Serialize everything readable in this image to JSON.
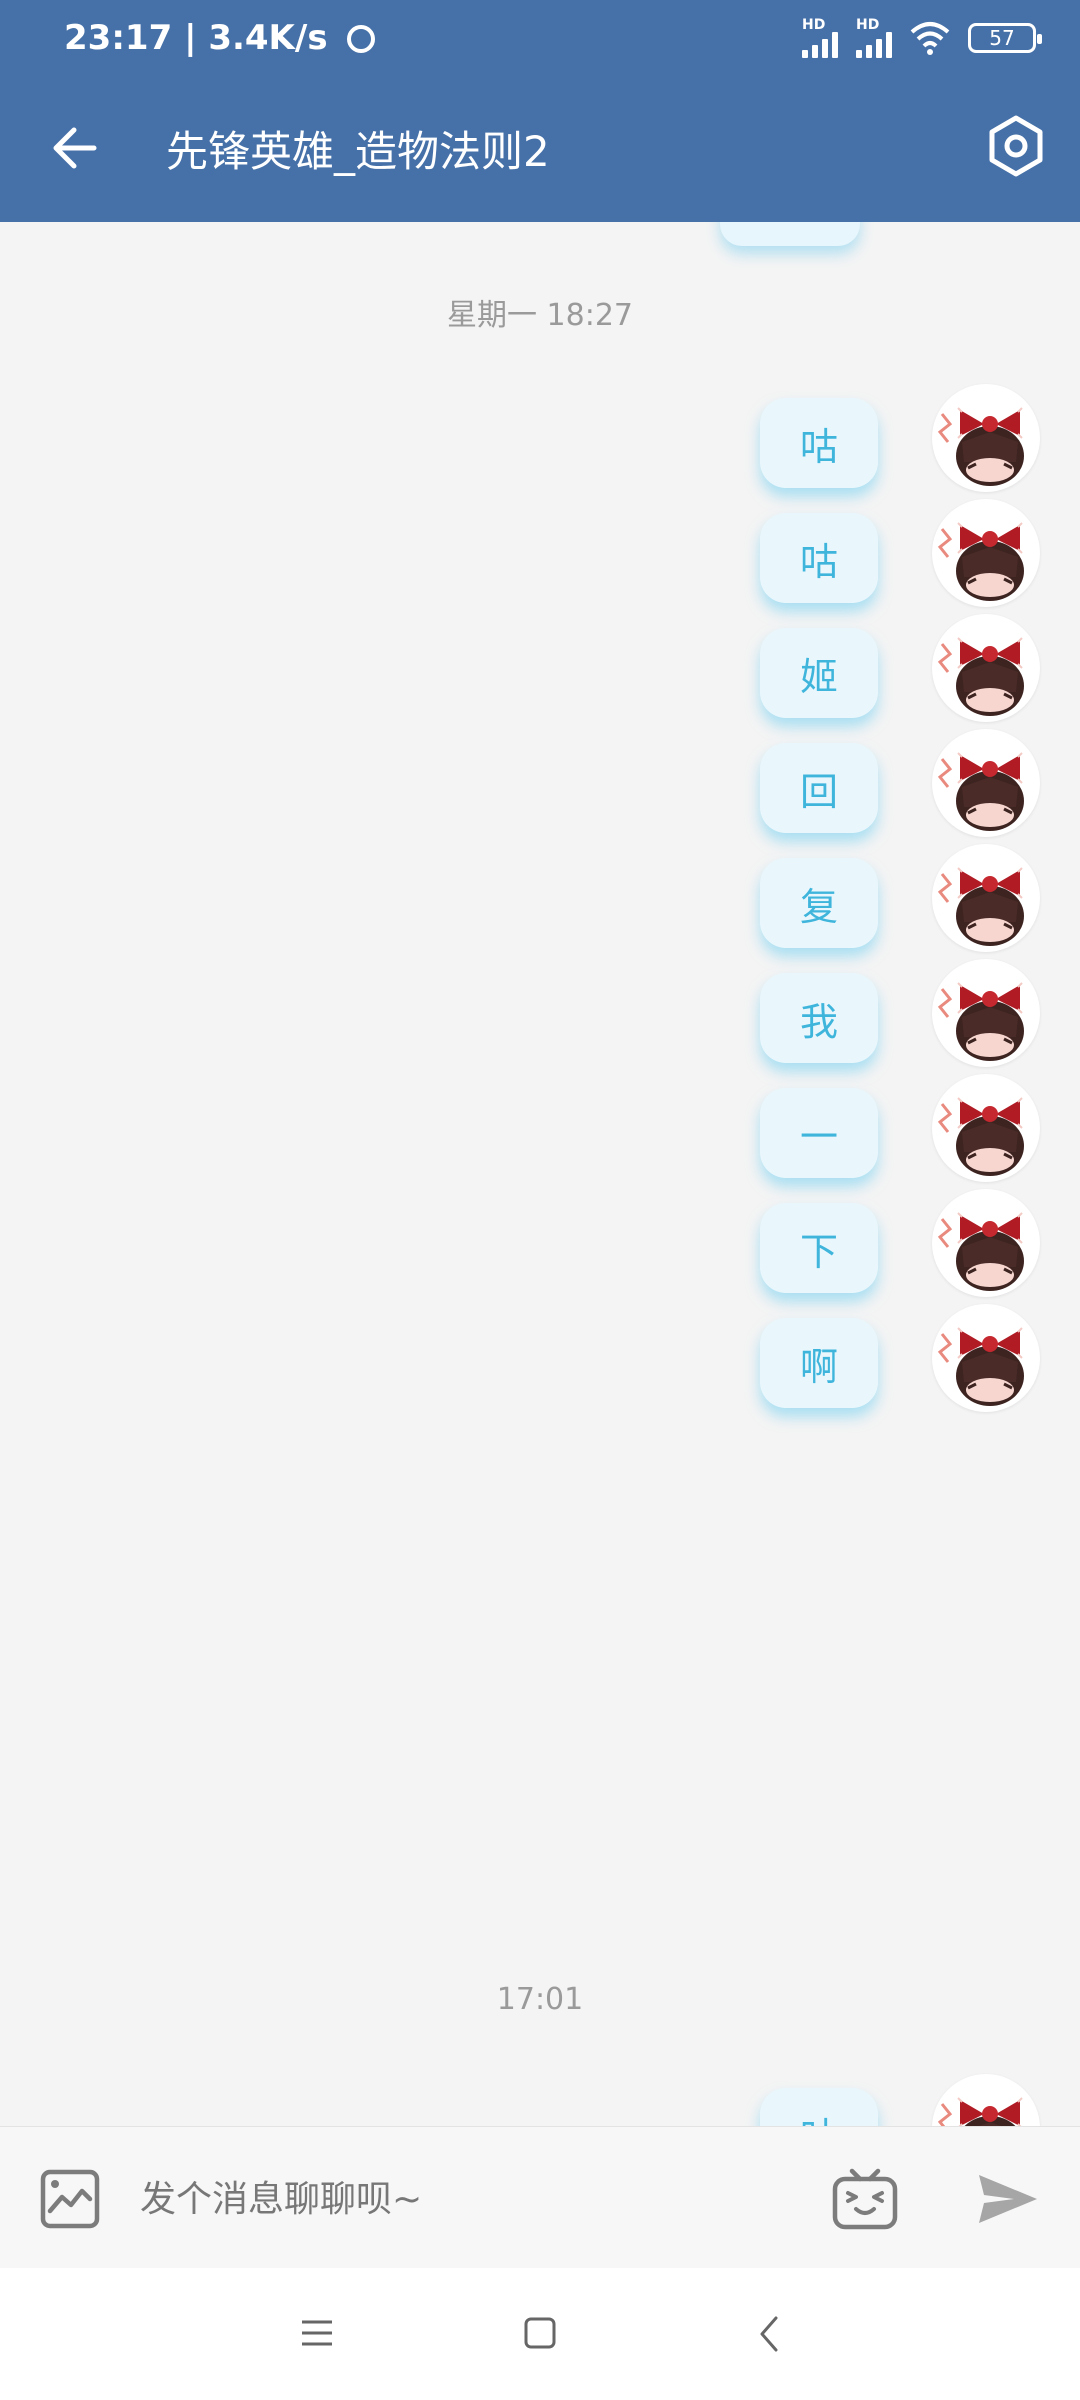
{
  "status_bar": {
    "time_speed": "23:17 | 3.4K/s",
    "battery": "57",
    "signal_label": "HD"
  },
  "header": {
    "title": "先锋英雄_造物法则2"
  },
  "chat": {
    "time_1": "星期一 18:27",
    "messages": [
      "咕",
      "咕",
      "姬",
      "回",
      "复",
      "我",
      "一",
      "下",
      "啊"
    ],
    "time_2": "17:01",
    "partial_message": "咕"
  },
  "input": {
    "placeholder": "发个消息聊聊呗~"
  },
  "colors": {
    "header": "#4671a8",
    "bubble_bg": "#e9f7fd",
    "bubble_text": "#3fb5dc",
    "background": "#f4f4f4"
  },
  "icons": {
    "back": "arrow-left-icon",
    "settings": "hexagon-settings-icon",
    "image": "image-picture-icon",
    "emoji": "emoticon-tv-face-icon",
    "send": "paper-plane-send-icon"
  }
}
